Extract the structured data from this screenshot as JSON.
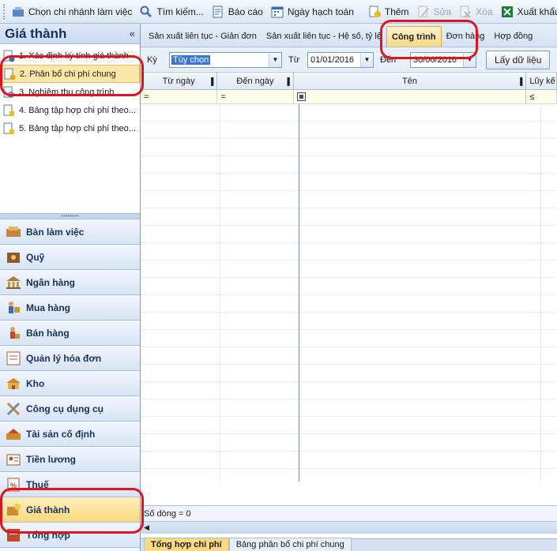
{
  "toolbar": {
    "items": [
      {
        "label": "Chọn chi nhánh làm việc",
        "icon": "branch-icon",
        "disabled": false
      },
      {
        "label": "Tìm kiếm...",
        "icon": "search-icon",
        "disabled": false
      },
      {
        "label": "Báo cáo",
        "icon": "report-icon",
        "disabled": false
      },
      {
        "label": "Ngày hạch toán",
        "icon": "calendar-icon",
        "disabled": false
      },
      {
        "label": "Thêm",
        "icon": "add-icon",
        "disabled": false
      },
      {
        "label": "Sửa",
        "icon": "edit-icon",
        "disabled": true
      },
      {
        "label": "Xóa",
        "icon": "delete-icon",
        "disabled": true
      },
      {
        "label": "Xuất khẩu",
        "icon": "excel-icon",
        "disabled": false
      }
    ]
  },
  "left_panel": {
    "title": "Giá thành",
    "collapse_symbol": "«",
    "tree_items": [
      {
        "label": "1. Xác định kỳ tính giá thành"
      },
      {
        "label": "2. Phân bổ chi phí chung"
      },
      {
        "label": "3. Nghiệm thu công trình"
      },
      {
        "label": "4. Bảng tập hợp chi phí theo..."
      },
      {
        "label": "5. Bảng tập hợp chi phí theo..."
      }
    ],
    "selected_index": 1,
    "nav_buttons": [
      {
        "label": "Bàn làm việc",
        "icon": "desk-icon"
      },
      {
        "label": "Quỹ",
        "icon": "cash-icon"
      },
      {
        "label": "Ngân hàng",
        "icon": "bank-icon"
      },
      {
        "label": "Mua hàng",
        "icon": "purchase-icon"
      },
      {
        "label": "Bán hàng",
        "icon": "sales-icon"
      },
      {
        "label": "Quản lý hóa đơn",
        "icon": "invoice-icon"
      },
      {
        "label": "Kho",
        "icon": "warehouse-icon"
      },
      {
        "label": "Công cụ dụng cụ",
        "icon": "tools-icon"
      },
      {
        "label": "Tài sản cố định",
        "icon": "assets-icon"
      },
      {
        "label": "Tiền lương",
        "icon": "payroll-icon"
      },
      {
        "label": "Thuế",
        "icon": "tax-icon"
      },
      {
        "label": "Giá thành",
        "icon": "cost-icon"
      },
      {
        "label": "Tổng hợp",
        "icon": "summary-icon"
      }
    ],
    "active_nav": "Giá thành"
  },
  "tabs": [
    {
      "label": "Sản xuất liên tục - Giản đơn"
    },
    {
      "label": "Sản xuất liên tục - Hệ số, tỷ lệ"
    },
    {
      "label": "Công trình"
    },
    {
      "label": "Đơn hàng"
    },
    {
      "label": "Hợp đồng"
    }
  ],
  "active_tab": "Công trình",
  "filter": {
    "period_label": "Kỳ",
    "period_value": "Tùy chọn",
    "from_label": "Từ",
    "from_value": "01/01/2016",
    "to_label": "Đến",
    "to_value": "30/06/2016",
    "fetch_button": "Lấy dữ liệu"
  },
  "grid": {
    "columns": [
      "Từ ngày",
      "Đến ngày",
      "Tên",
      "Lũy kế"
    ],
    "filter_row": [
      "=",
      "=",
      "",
      "≤"
    ],
    "row_count_text": "Số dòng = 0"
  },
  "bottom_tabs": [
    {
      "label": "Tổng hợp chi phí"
    },
    {
      "label": "Bảng phân bổ chi phí chung"
    }
  ],
  "colors": {
    "accent": "#fcd97e",
    "annotation": "#e0141e",
    "selection": "#3875d7"
  }
}
